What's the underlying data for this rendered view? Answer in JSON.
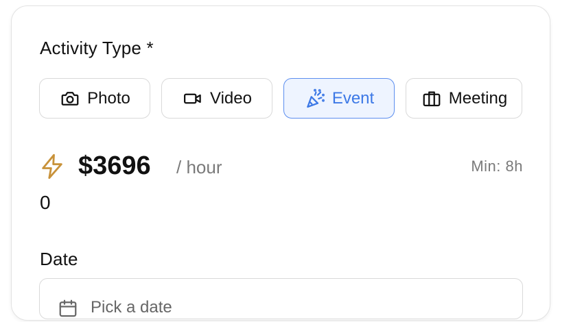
{
  "form": {
    "activity_label": "Activity Type *",
    "types": [
      {
        "label": "Photo",
        "icon": "camera-icon",
        "selected": false
      },
      {
        "label": "Video",
        "icon": "video-camera-icon",
        "selected": false
      },
      {
        "label": "Event",
        "icon": "party-popper-icon",
        "selected": true
      },
      {
        "label": "Meeting",
        "icon": "briefcase-icon",
        "selected": false
      }
    ],
    "rate": {
      "icon": "lightning-bolt-icon",
      "price": "$3696",
      "unit": "/ hour",
      "minimum": "Min: 8h"
    },
    "count_value": "0",
    "date_label": "Date",
    "date_placeholder": "Pick a date"
  },
  "colors": {
    "accent": "#3c78e6",
    "accent_border": "#5b8def",
    "accent_bg": "#eef4ff",
    "bolt": "#c8923a",
    "muted": "#7a7a7a",
    "border": "#d9d9d9"
  }
}
